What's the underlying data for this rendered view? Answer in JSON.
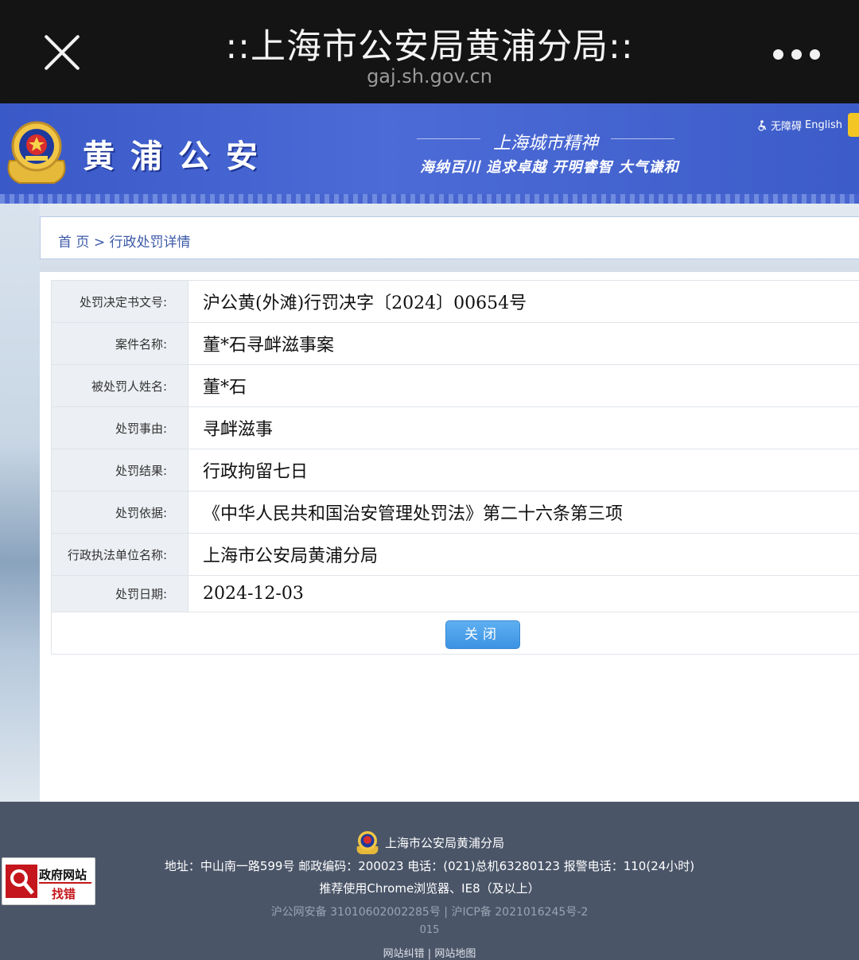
{
  "app_bar": {
    "title": "::上海市公安局黄浦分局::",
    "url": "gaj.sh.gov.cn"
  },
  "banner": {
    "site_name": "黄浦公安",
    "slogan_title": "上海城市精神",
    "slogan": "海纳百川 追求卓越 开明睿智 大气谦和",
    "accessibility_link": "无障碍",
    "english_link": "English"
  },
  "breadcrumb": {
    "home": "首 页",
    "separator": ">",
    "current": "行政处罚详情"
  },
  "detail": {
    "rows": [
      {
        "label": "处罚决定书文号:",
        "value": "沪公黄(外滩)行罚决字〔2024〕00654号"
      },
      {
        "label": "案件名称:",
        "value": "董*石寻衅滋事案"
      },
      {
        "label": "被处罚人姓名:",
        "value": "董*石"
      },
      {
        "label": "处罚事由:",
        "value": "寻衅滋事"
      },
      {
        "label": "处罚结果:",
        "value": "行政拘留七日"
      },
      {
        "label": "处罚依据:",
        "value": "《中华人民共和国治安管理处罚法》第二十六条第三项"
      },
      {
        "label": "行政执法单位名称:",
        "value": "上海市公安局黄浦分局"
      },
      {
        "label": "处罚日期:",
        "value": "2024-12-03"
      }
    ],
    "close_label": "关闭"
  },
  "footer": {
    "org": "上海市公安局黄浦分局",
    "address_line": "地址：中山南一路599号 邮政编码：200023 电话：(021)总机63280123 报警电话：110(24小时)",
    "browser_line": "推荐使用Chrome浏览器、IE8（及以上）",
    "record_line": "沪公网安备 31010602002285号 | 沪ICP备 2021016245号-2",
    "partial_line": "015",
    "links_line": "网站纠错 | 网站地图",
    "gov_badge_top": "政府网站",
    "gov_badge_bottom": "找错"
  },
  "colors": {
    "banner_blue": "#4463d2",
    "button_blue": "#4aa0ea",
    "footer_gray": "#4a5568",
    "link_blue": "#3d5aa8"
  }
}
